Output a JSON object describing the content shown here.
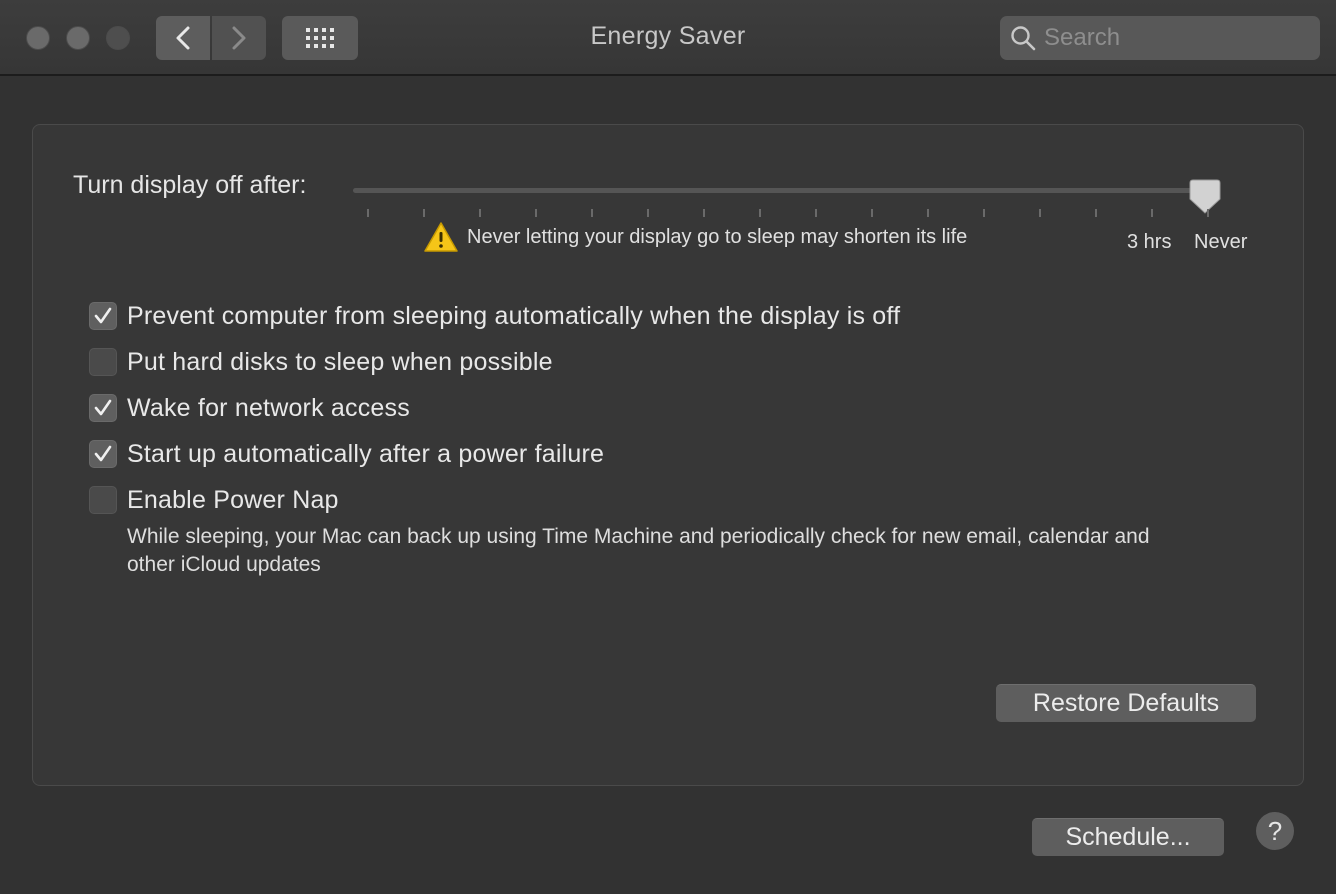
{
  "window": {
    "title": "Energy Saver"
  },
  "toolbar": {
    "back_icon": "chevron-left-icon",
    "forward_icon": "chevron-right-icon",
    "grid_icon": "show-all-grid-icon"
  },
  "search": {
    "placeholder": "Search",
    "value": ""
  },
  "display_sleep": {
    "label": "Turn display off after:",
    "value": "Never",
    "tick_labels": [
      "3 hrs",
      "Never"
    ],
    "warning": "Never letting your display go to sleep may shorten its life"
  },
  "options": [
    {
      "label": "Prevent computer from sleeping automatically when the display is off",
      "checked": true
    },
    {
      "label": "Put hard disks to sleep when possible",
      "checked": false
    },
    {
      "label": "Wake for network access",
      "checked": true
    },
    {
      "label": "Start up automatically after a power failure",
      "checked": true
    },
    {
      "label": "Enable Power Nap",
      "checked": false
    }
  ],
  "power_nap_description": "While sleeping, your Mac can back up using Time Machine and periodically check for new email, calendar and other iCloud updates",
  "buttons": {
    "restore_defaults": "Restore Defaults",
    "schedule": "Schedule...",
    "help": "?"
  },
  "colors": {
    "window_bg": "#323232",
    "panel_bg": "#373737",
    "control_bg": "#5e5e5e",
    "warning_yellow": "#f5c518"
  }
}
